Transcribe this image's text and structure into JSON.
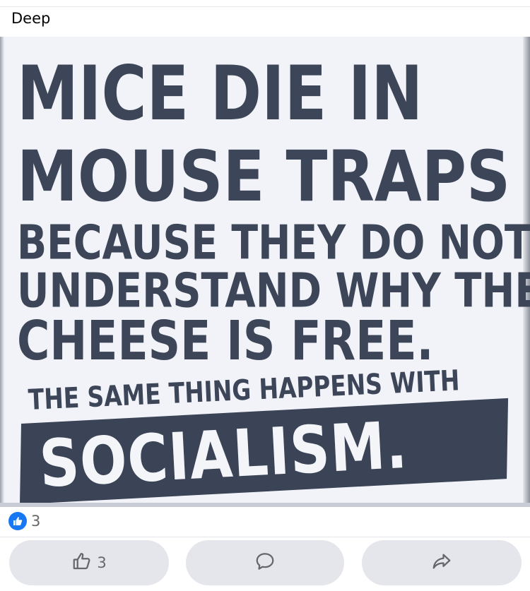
{
  "post": {
    "caption": "Deep"
  },
  "image_text": {
    "line1": "MICE DIE IN",
    "line2": "MOUSE TRAPS",
    "line3": "BECAUSE THEY DO NOT",
    "line4": "UNDERSTAND WHY THE",
    "line5": "CHEESE IS FREE.",
    "line6": "THE SAME THING HAPPENS WITH",
    "line7": "SOCIALISM."
  },
  "reactions": {
    "icon": "like-icon",
    "count": "3"
  },
  "actions": {
    "like_count": "3",
    "like_icon": "thumbs-up-icon",
    "comment_icon": "comment-icon",
    "share_icon": "share-icon"
  },
  "colors": {
    "ink": "#3c4658",
    "like_blue": "#1877f2",
    "button_bg": "#e4e6eb",
    "muted_text": "#65676b"
  }
}
